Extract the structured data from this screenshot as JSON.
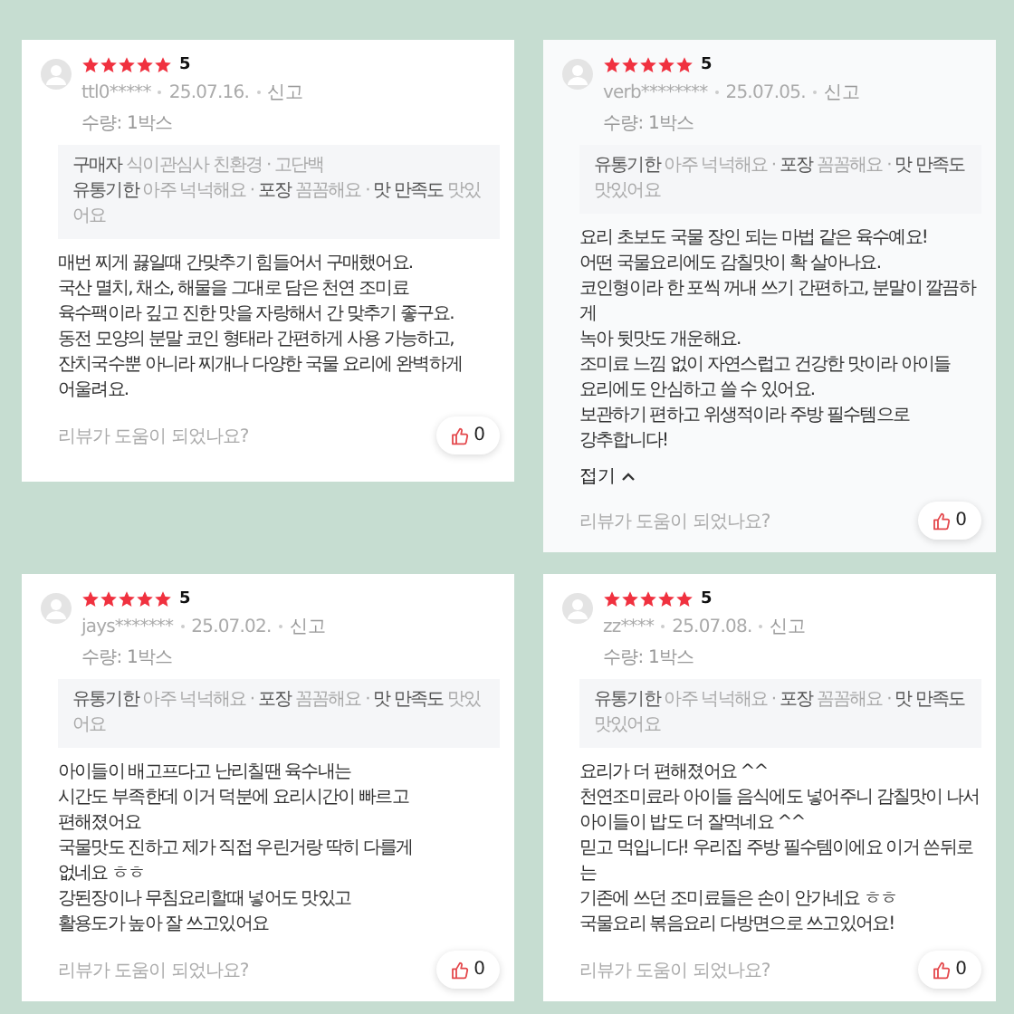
{
  "reviews": [
    {
      "stars": 5,
      "score": "5",
      "user": "ttl0*****",
      "date": "25.07.16.",
      "report": "신고",
      "quantity": "수량: 1박스",
      "options": "**구매자** 식이관심사 친환경 · 고단백\n**유통기한** 아주 넉넉해요 · **포장** 꼼꼼해요 · **맛 만족도** 맛있어요",
      "body": "매번 찌게 끓일때 간맞추기 힘들어서 구매했어요.\n국산 멸치, 채소, 해물을 그대로 담은 천연 조미료\n육수팩이라 깊고 진한 맛을 자랑해서 간 맞추기 좋구요.\n동전 모양의 분말 코인 형태라 간편하게 사용 가능하고,\n잔치국수뿐 아니라 찌개나 다양한 국물 요리에 완벽하게\n어울려요.",
      "helpful": "리뷰가 도움이 되었나요?",
      "likes": "0"
    },
    {
      "stars": 5,
      "score": "5",
      "user": "verb********",
      "date": "25.07.05.",
      "report": "신고",
      "quantity": "수량: 1박스",
      "options": "**유통기한** 아주 넉넉해요 · **포장** 꼼꼼해요 · **맛 만족도** 맛있어요",
      "body": "요리 초보도 국물 장인 되는 마법 같은 육수예요!\n어떤 국물요리에도 감칠맛이 확 살아나요.\n코인형이라 한 포씩 꺼내 쓰기 간편하고, 분말이 깔끔하게\n녹아 뒷맛도 개운해요.\n조미료 느낌 없이 자연스럽고 건강한 맛이라 아이들\n요리에도 안심하고 쓸 수 있어요.\n보관하기 편하고 위생적이라 주방 필수템으로\n강추합니다!",
      "collapse": "접기",
      "helpful": "리뷰가 도움이 되었나요?",
      "likes": "0"
    },
    {
      "stars": 5,
      "score": "5",
      "user": "jays*******",
      "date": "25.07.02.",
      "report": "신고",
      "quantity": "수량: 1박스",
      "options": "**유통기한** 아주 넉넉해요 · **포장** 꼼꼼해요 · **맛 만족도** 맛있어요",
      "body": "아이들이 배고프다고 난리칠땐 육수내는\n시간도 부족한데 이거 덕분에 요리시간이 빠르고\n편해졌어요\n국물맛도 진하고 제가 직접 우린거랑 딱히 다를게\n없네요 ㅎㅎ\n강된장이나 무침요리할때 넣어도 맛있고\n활용도가 높아 잘 쓰고있어요",
      "helpful": "리뷰가 도움이 되었나요?",
      "likes": "0"
    },
    {
      "stars": 5,
      "score": "5",
      "user": "zz****",
      "date": "25.07.08.",
      "report": "신고",
      "quantity": "수량: 1박스",
      "options": "**유통기한** 아주 넉넉해요 · **포장** 꼼꼼해요 · **맛 만족도** 맛있어요",
      "body": "요리가 더 편해졌어요 ^^\n천연조미료라 아이들 음식에도 넣어주니 감칠맛이 나서\n아이들이 밥도 더 잘먹네요 ^^\n믿고 먹입니다! 우리집 주방 필수템이에요 이거 쓴뒤로는\n기존에 쓰던 조미료들은 손이 안가네요 ㅎㅎ\n국물요리 볶음요리 다방면으로 쓰고있어요!",
      "helpful": "리뷰가 도움이 되었나요?",
      "likes": "0"
    }
  ]
}
